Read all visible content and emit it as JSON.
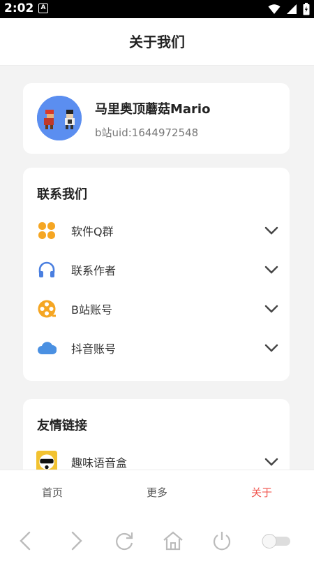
{
  "status": {
    "time": "2:02",
    "notif_glyph": "A"
  },
  "header": {
    "title": "关于我们"
  },
  "profile": {
    "name": "马里奥顶蘑菇Mario",
    "uid": "b站uid:1644972548",
    "avatar_bg": "#5b8ef0"
  },
  "contact": {
    "title": "联系我们",
    "items": [
      {
        "label": "软件Q群",
        "icon": "four-petal-icon",
        "color": "#f5a623"
      },
      {
        "label": "联系作者",
        "icon": "headphones-icon",
        "color": "#4a7fe0"
      },
      {
        "label": "B站账号",
        "icon": "film-reel-icon",
        "color": "#f5a623"
      },
      {
        "label": "抖音账号",
        "icon": "cloud-icon",
        "color": "#4a90e2"
      }
    ]
  },
  "friends": {
    "title": "友情链接",
    "items": [
      {
        "label": "趣味语音盒",
        "icon": "app-thumbnail-icon"
      }
    ]
  },
  "tabs": [
    {
      "label": "首页",
      "active": false
    },
    {
      "label": "更多",
      "active": false
    },
    {
      "label": "关于",
      "active": true
    }
  ],
  "colors": {
    "accent": "#f0554e",
    "background": "#f3f3f3"
  }
}
